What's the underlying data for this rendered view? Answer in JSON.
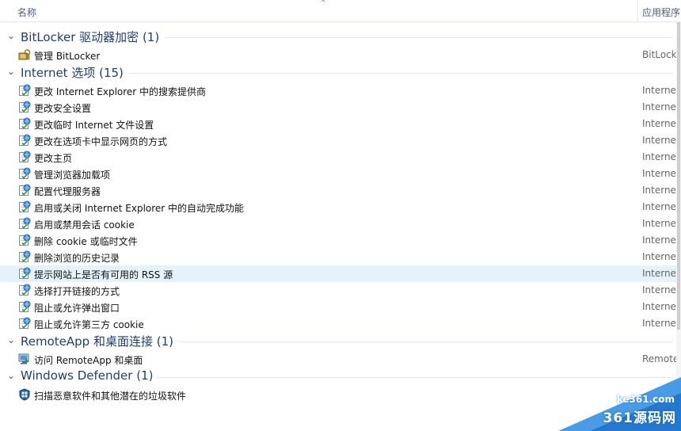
{
  "header": {
    "name_col": "名称",
    "app_col": "应用程序"
  },
  "groups": [
    {
      "title": "BitLocker 驱动器加密 (1)",
      "items": [
        {
          "label": "管理 BitLocker",
          "app": "BitLocker",
          "icon": "bitlocker-icon"
        }
      ]
    },
    {
      "title": "Internet 选项 (15)",
      "items": [
        {
          "label": "更改 Internet Explorer 中的搜索提供商",
          "app": "Internet",
          "icon": "internet-options-icon"
        },
        {
          "label": "更改安全设置",
          "app": "Internet",
          "icon": "internet-options-icon"
        },
        {
          "label": "更改临时 Internet 文件设置",
          "app": "Internet",
          "icon": "internet-options-icon"
        },
        {
          "label": "更改在选项卡中显示网页的方式",
          "app": "Internet",
          "icon": "internet-options-icon"
        },
        {
          "label": "更改主页",
          "app": "Internet",
          "icon": "internet-options-icon"
        },
        {
          "label": "管理浏览器加载项",
          "app": "Internet",
          "icon": "internet-options-icon"
        },
        {
          "label": "配置代理服务器",
          "app": "Internet",
          "icon": "internet-options-icon"
        },
        {
          "label": "启用或关闭 Internet Explorer 中的自动完成功能",
          "app": "Internet",
          "icon": "internet-options-icon"
        },
        {
          "label": "启用或禁用会话 cookie",
          "app": "Internet",
          "icon": "internet-options-icon"
        },
        {
          "label": "删除 cookie 或临时文件",
          "app": "Internet",
          "icon": "internet-options-icon"
        },
        {
          "label": "删除浏览的历史记录",
          "app": "Internet",
          "icon": "internet-options-icon"
        },
        {
          "label": "提示网站上是否有可用的 RSS 源",
          "app": "Internet",
          "icon": "internet-options-icon",
          "highlighted": true
        },
        {
          "label": "选择打开链接的方式",
          "app": "Internet",
          "icon": "internet-options-icon"
        },
        {
          "label": "阻止或允许弹出窗口",
          "app": "Internet",
          "icon": "internet-options-icon"
        },
        {
          "label": "阻止或允许第三方 cookie",
          "app": "Internet",
          "icon": "internet-options-icon"
        }
      ]
    },
    {
      "title": "RemoteApp 和桌面连接 (1)",
      "items": [
        {
          "label": "访问 RemoteApp 和桌面",
          "app": "Remote",
          "icon": "remoteapp-icon"
        }
      ]
    },
    {
      "title": "Windows Defender (1)",
      "items": [
        {
          "label": "扫描恶意软件和其他潜在的垃圾软件",
          "app": "",
          "icon": "windows-defender-icon"
        }
      ]
    }
  ],
  "watermark": {
    "site": "ke361.com",
    "brand": "361源码网"
  },
  "colors": {
    "group_title": "#1e3e7a",
    "highlight": "#e5f1fb",
    "watermark": "#2a8ae0"
  }
}
